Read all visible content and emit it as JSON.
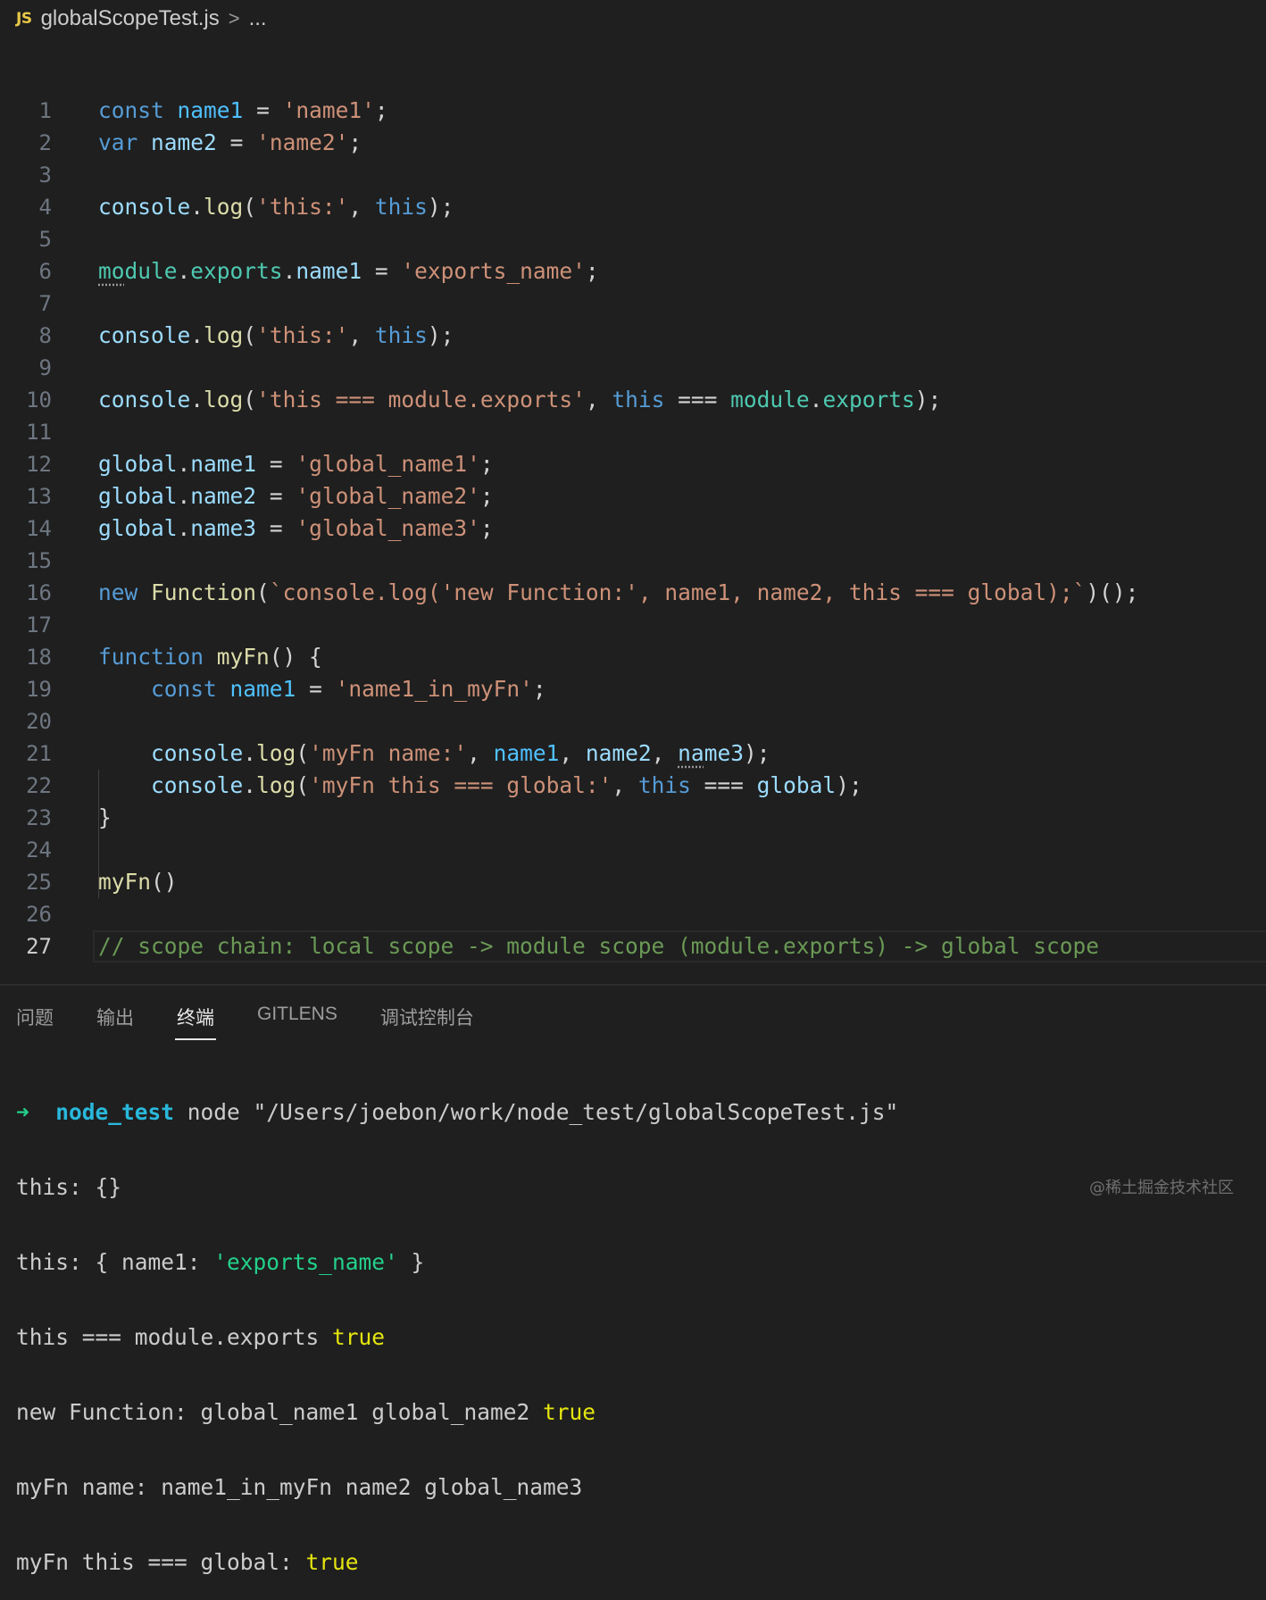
{
  "breadcrumb": {
    "file_icon": "JS",
    "filename": "globalScopeTest.js",
    "separator": ">",
    "more": "..."
  },
  "editor": {
    "current_line": 27,
    "line_numbers": [
      "1",
      "2",
      "3",
      "4",
      "5",
      "6",
      "7",
      "8",
      "9",
      "10",
      "11",
      "12",
      "13",
      "14",
      "15",
      "16",
      "17",
      "18",
      "19",
      "20",
      "21",
      "22",
      "23",
      "24",
      "25",
      "26",
      "27"
    ]
  },
  "panel": {
    "tabs": [
      {
        "label": "问题",
        "active": false
      },
      {
        "label": "输出",
        "active": false
      },
      {
        "label": "终端",
        "active": true
      },
      {
        "label": "GITLENS",
        "active": false
      },
      {
        "label": "调试控制台",
        "active": false
      }
    ]
  },
  "terminal": {
    "prompt_arrow": "➜",
    "prompt_dir": "node_test",
    "command": " node \"/Users/joebon/work/node_test/globalScopeTest.js\"",
    "out1": "this: {}",
    "out2_a": "this: { name1: ",
    "out2_b": "'exports_name'",
    "out2_c": " }",
    "out3_a": "this === module.exports ",
    "out3_b": "true",
    "out4_a": "new Function: global_name1 global_name2 ",
    "out4_b": "true",
    "out5": "myFn name: name1_in_myFn name2 global_name3",
    "out6_a": "myFn this === global: ",
    "out6_b": "true"
  },
  "watermark": "@稀土掘金技术社区",
  "colors": {
    "background": "#1f1f1f",
    "keyword": "#569cd6",
    "string": "#ce9178",
    "function": "#dcdcaa",
    "object": "#4ec9b0",
    "comment": "#6a9955",
    "terminal_green": "#23d18b",
    "terminal_yellow": "#e5e510"
  },
  "icons": [
    "js-file-icon",
    "chevron-right-icon"
  ]
}
